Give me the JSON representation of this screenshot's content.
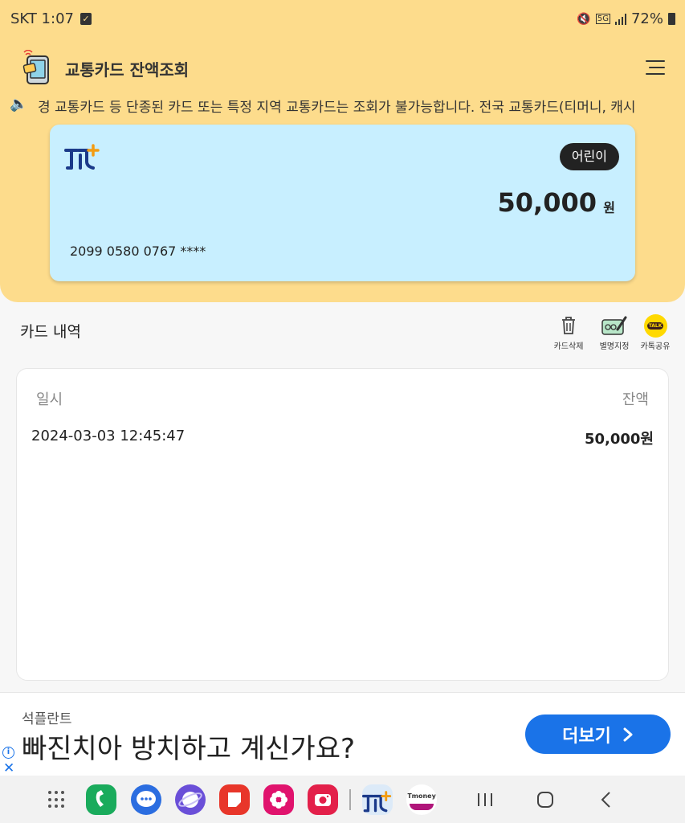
{
  "status": {
    "carrier_time": "SKT 1:07",
    "network": "5G",
    "battery": "72%"
  },
  "app": {
    "title": "교통카드 잔액조회"
  },
  "marquee": {
    "text": "경 교통카드 등 단종된 카드 또는 특정 지역 교통카드는 조회가 불가능합니다. 전국 교통카드(티머니, 캐시"
  },
  "card": {
    "badge": "어린이",
    "balance": "50,000",
    "unit": "원",
    "number": "2099 0580 0767 ****"
  },
  "history": {
    "title": "카드 내역",
    "actions": [
      {
        "label": "카드삭제",
        "icon": "trash-icon"
      },
      {
        "label": "별명지정",
        "icon": "edit-card-icon"
      },
      {
        "label": "카톡공유",
        "icon": "kakao-talk-icon"
      }
    ],
    "kakao_badge": "TALK",
    "columns": {
      "date": "일시",
      "balance": "잔액"
    },
    "rows": [
      {
        "date": "2024-03-03 12:45:47",
        "balance": "50,000원"
      }
    ]
  },
  "ad": {
    "brand": "석플란트",
    "headline": "빠진치아 방치하고 계신가요?",
    "button": "더보기"
  },
  "dock": {
    "tmoney_label": "Tmoney"
  },
  "colors": {
    "header_bg": "#fddc8c",
    "card_bg": "#c8efff",
    "ad_button": "#1a73e8"
  }
}
